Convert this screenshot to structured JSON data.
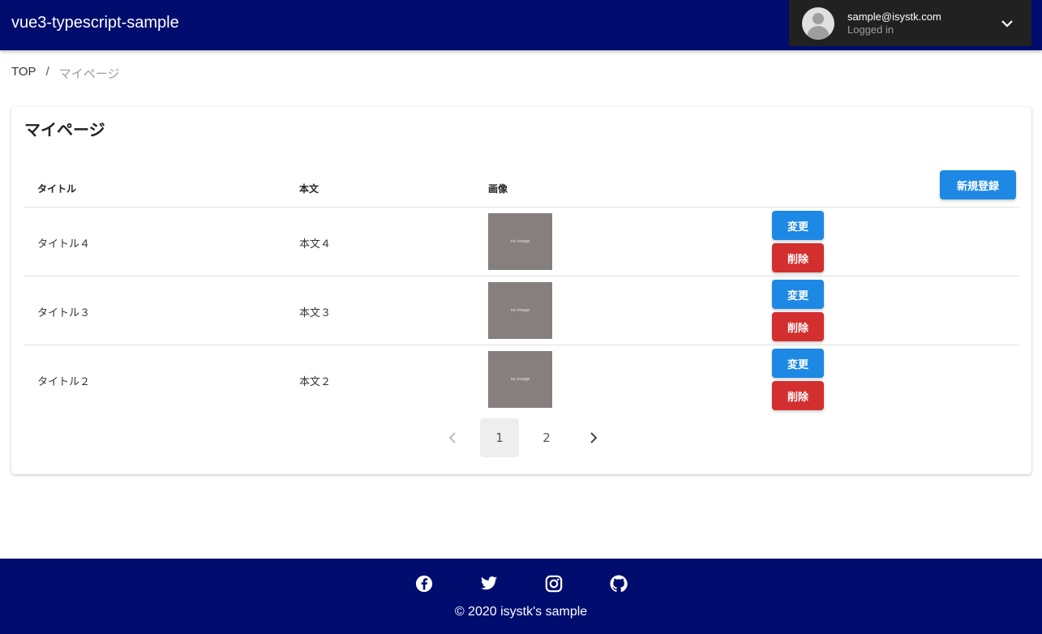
{
  "app": {
    "title": "vue3-typescript-sample"
  },
  "user": {
    "email": "sample@isystk.com",
    "status": "Logged in",
    "avatar_icon": "account-circle-icon"
  },
  "breadcrumb": {
    "home": "TOP",
    "separator": "/",
    "current": "マイページ"
  },
  "page": {
    "title": "マイページ"
  },
  "table": {
    "headers": {
      "title": "タイトル",
      "body": "本文",
      "image": "画像"
    },
    "new_button": "新規登録",
    "rows": [
      {
        "title": "タイトル４",
        "body": "本文４",
        "image_label": "no image",
        "edit": "変更",
        "delete": "削除"
      },
      {
        "title": "タイトル３",
        "body": "本文３",
        "image_label": "no image",
        "edit": "変更",
        "delete": "削除"
      },
      {
        "title": "タイトル２",
        "body": "本文２",
        "image_label": "no image",
        "edit": "変更",
        "delete": "削除"
      }
    ]
  },
  "pagination": {
    "pages": [
      "1",
      "2"
    ],
    "current": "1"
  },
  "footer": {
    "icons": [
      "facebook-icon",
      "twitter-icon",
      "instagram-icon",
      "github-icon"
    ],
    "copyright": "© 2020 isystk's sample"
  },
  "colors": {
    "appbar": "#000c6e",
    "primary": "#1e88e5",
    "danger": "#d32f2f",
    "user_menu": "#212121"
  }
}
